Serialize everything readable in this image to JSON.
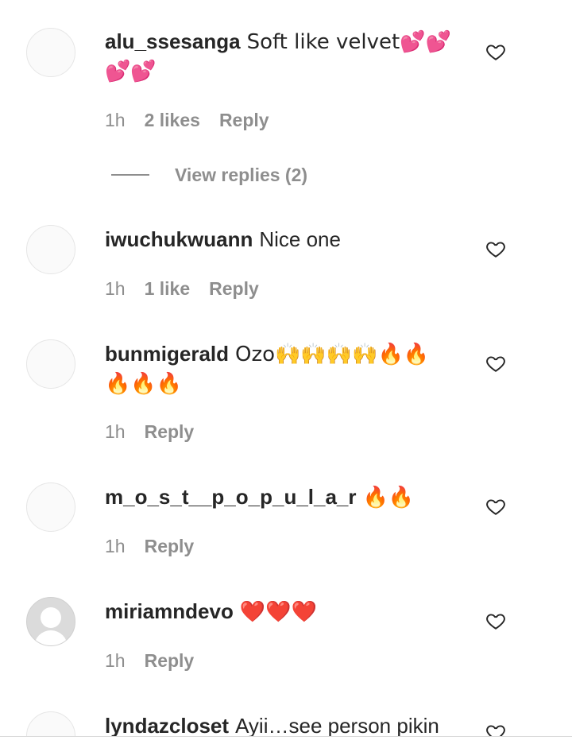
{
  "comments": [
    {
      "username": "alu_ssesanga",
      "text": "Soft like velvet💕💕💕💕",
      "time": "1h",
      "likes": "2 likes",
      "reply": "Reply",
      "view_replies": "View replies (2)"
    },
    {
      "username": "iwuchukwuann",
      "text": "Nice one",
      "time": "1h",
      "likes": "1 like",
      "reply": "Reply"
    },
    {
      "username": "bunmigerald",
      "text": "Ozo🙌🙌🙌🙌🔥🔥🔥🔥🔥",
      "time": "1h",
      "reply": "Reply"
    },
    {
      "username": "m_o_s_t__p_o_p_u_l_a_r",
      "text": "🔥🔥",
      "time": "1h",
      "reply": "Reply"
    },
    {
      "username": "miriamndevo",
      "text": "❤️❤️❤️",
      "time": "1h",
      "reply": "Reply"
    },
    {
      "username": "lyndazcloset",
      "text": "Ayii…see person pikin"
    }
  ],
  "icons": {
    "like": "heart-outline-icon",
    "avatar_default": "default-avatar-icon"
  },
  "colors": {
    "text": "#262626",
    "secondary": "#8e8e8e"
  }
}
